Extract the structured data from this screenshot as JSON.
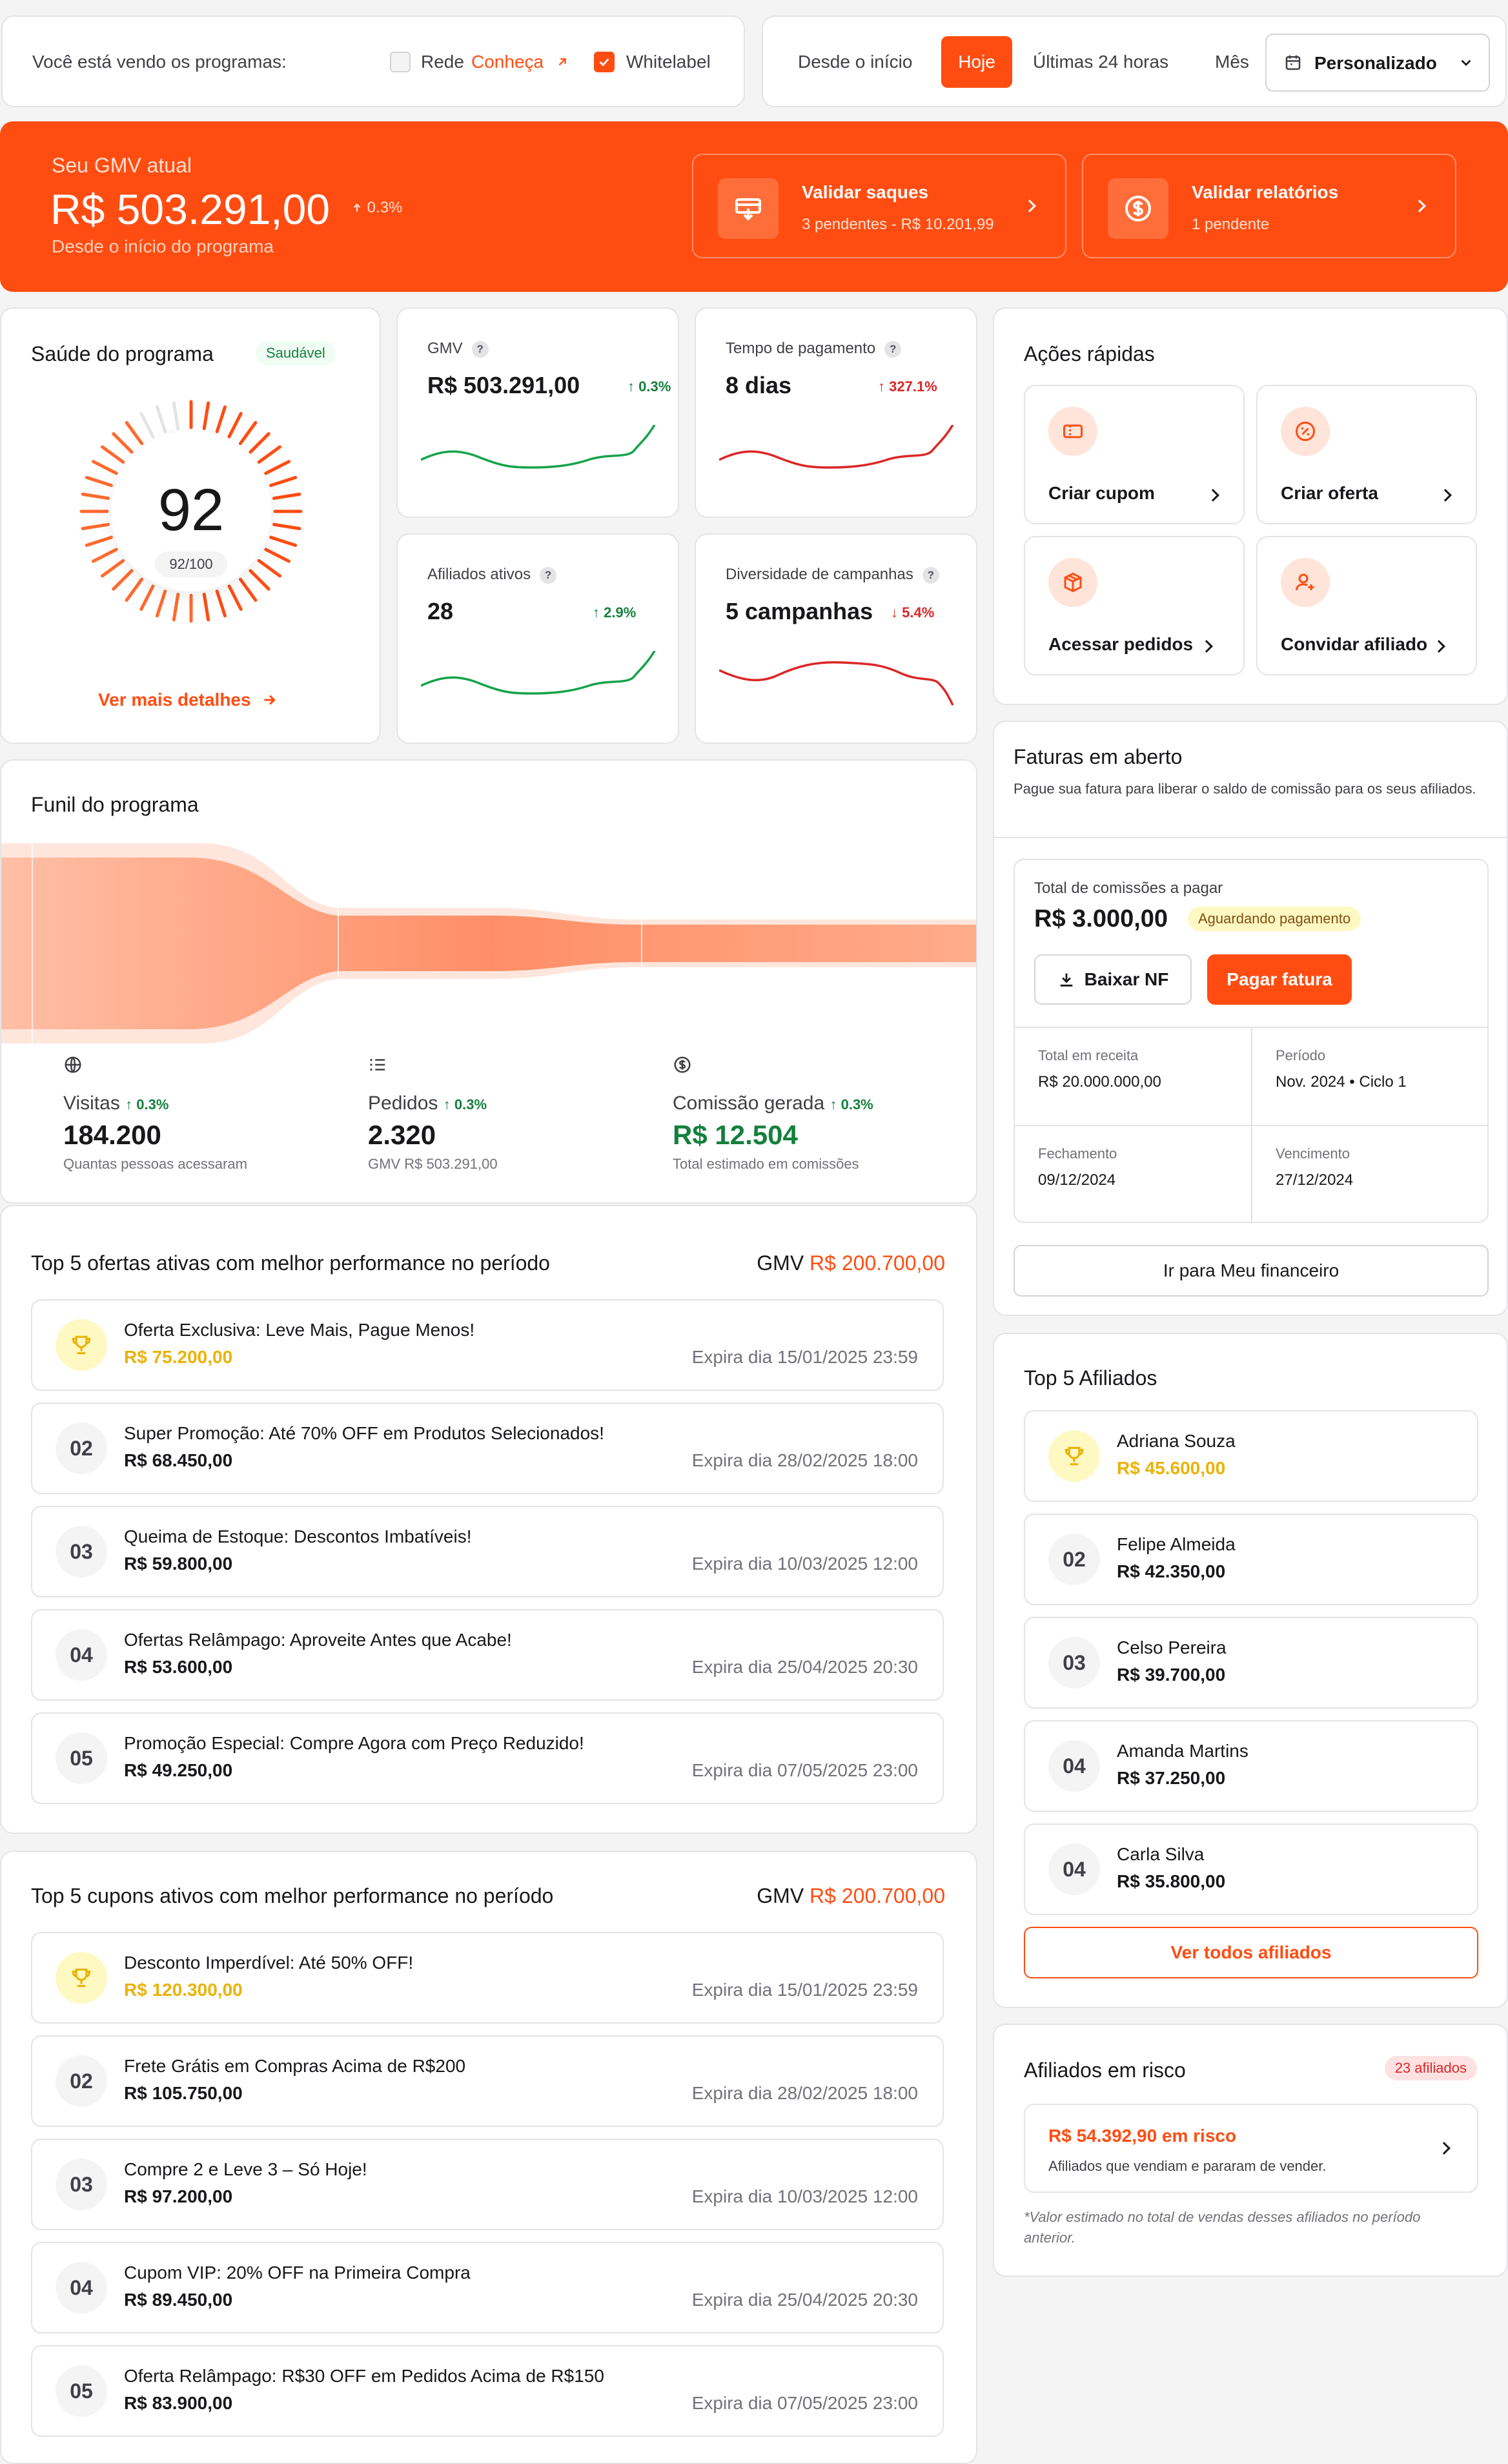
{
  "filter_bar": {
    "label": "Você está vendo os programas:",
    "rede_label": "Rede",
    "rede_link": "Conheça",
    "whitelabel_label": "Whitelabel"
  },
  "period_bar": {
    "options": [
      "Desde o início",
      "Hoje",
      "Últimas 24 horas",
      "Mês"
    ],
    "active": "Hoje",
    "custom_label": "Personalizado"
  },
  "hero": {
    "label": "Seu GMV atual",
    "value": "R$ 503.291,00",
    "change": "0.3%",
    "sub": "Desde o início do programa",
    "actions": [
      {
        "title": "Validar saques",
        "sub": "3 pendentes - R$ 10.201,99",
        "icon": "withdraw-icon"
      },
      {
        "title": "Validar relatórios",
        "sub": "1 pendente",
        "icon": "dollar-icon"
      }
    ]
  },
  "health": {
    "title": "Saúde do programa",
    "badge": "Saudável",
    "score": "92",
    "score_sub": "92/100",
    "score_value": 92,
    "link": "Ver mais detalhes"
  },
  "metrics": [
    {
      "label": "GMV",
      "value": "R$ 503.291,00",
      "change": "0.3%",
      "trend": "up"
    },
    {
      "label": "Tempo de pagamento",
      "value": "8 dias",
      "change": "327.1%",
      "trend": "up-bad"
    },
    {
      "label": "Afiliados ativos",
      "value": "28",
      "change": "2.9%",
      "trend": "up"
    },
    {
      "label": "Diversidade de campanhas",
      "value": "5 campanhas",
      "change": "5.4%",
      "trend": "down"
    }
  ],
  "quick_actions": {
    "title": "Ações rápidas",
    "items": [
      {
        "label": "Criar cupom",
        "icon": "ticket-icon"
      },
      {
        "label": "Criar oferta",
        "icon": "percent-icon"
      },
      {
        "label": "Acessar pedidos",
        "icon": "box-icon"
      },
      {
        "label": "Convidar afiliado",
        "icon": "user-plus-icon"
      }
    ]
  },
  "funnel": {
    "title": "Funil do programa",
    "stages": [
      {
        "label": "Visitas",
        "change": "0.3%",
        "value": "184.200",
        "sub": "Quantas pessoas acessaram",
        "icon": "globe-icon"
      },
      {
        "label": "Pedidos",
        "change": "0.3%",
        "value": "2.320",
        "sub": "GMV R$ 503.291,00",
        "icon": "list-icon"
      },
      {
        "label": "Comissão gerada",
        "change": "0.3%",
        "value": "R$ 12.504",
        "sub": "Total estimado em comissões",
        "icon": "coin-icon"
      }
    ]
  },
  "invoices": {
    "title": "Faturas em aberto",
    "sub": "Pague sua fatura para liberar o saldo de comissão para os seus afiliados.",
    "total_label": "Total de comissões a pagar",
    "total_value": "R$ 3.000,00",
    "status": "Aguardando pagamento",
    "download_label": "Baixar NF",
    "pay_label": "Pagar fatura",
    "fields": [
      {
        "label": "Total em receita",
        "value": "R$ 20.000.000,00"
      },
      {
        "label": "Período",
        "value": "Nov. 2024 • Ciclo 1"
      },
      {
        "label": "Fechamento",
        "value": "09/12/2024"
      },
      {
        "label": "Vencimento",
        "value": "27/12/2024"
      }
    ],
    "link_label": "Ir para Meu financeiro"
  },
  "top_offers": {
    "title": "Top 5 ofertas ativas com melhor performance no período",
    "gmv_label": "GMV",
    "gmv_value": "R$ 200.700,00",
    "items": [
      {
        "rank": "",
        "title": "Oferta Exclusiva: Leve Mais, Pague Menos!",
        "value": "R$ 75.200,00",
        "expires": "Expira dia 15/01/2025 23:59"
      },
      {
        "rank": "02",
        "title": "Super Promoção: Até 70% OFF em Produtos Selecionados!",
        "value": "R$ 68.450,00",
        "expires": "Expira dia 28/02/2025 18:00"
      },
      {
        "rank": "03",
        "title": "Queima de Estoque: Descontos Imbatíveis!",
        "value": "R$ 59.800,00",
        "expires": "Expira dia 10/03/2025 12:00"
      },
      {
        "rank": "04",
        "title": "Ofertas Relâmpago: Aproveite Antes que Acabe!",
        "value": "R$ 53.600,00",
        "expires": "Expira dia 25/04/2025 20:30"
      },
      {
        "rank": "05",
        "title": "Promoção Especial: Compre Agora com Preço Reduzido!",
        "value": "R$ 49.250,00",
        "expires": "Expira dia 07/05/2025 23:00"
      }
    ]
  },
  "top_coupons": {
    "title": "Top 5 cupons ativos com melhor performance no período",
    "gmv_label": "GMV",
    "gmv_value": "R$ 200.700,00",
    "items": [
      {
        "rank": "",
        "title": "Desconto Imperdível: Até 50% OFF!",
        "value": "R$ 120.300,00",
        "expires": "Expira dia 15/01/2025 23:59"
      },
      {
        "rank": "02",
        "title": "Frete Grátis em Compras Acima de R$200",
        "value": "R$ 105.750,00",
        "expires": "Expira dia 28/02/2025 18:00"
      },
      {
        "rank": "03",
        "title": "Compre 2 e Leve 3 – Só Hoje!",
        "value": "R$ 97.200,00",
        "expires": "Expira dia 10/03/2025 12:00"
      },
      {
        "rank": "04",
        "title": "Cupom VIP: 20% OFF na Primeira Compra",
        "value": "R$ 89.450,00",
        "expires": "Expira dia 25/04/2025 20:30"
      },
      {
        "rank": "05",
        "title": "Oferta Relâmpago: R$30 OFF em Pedidos Acima de R$150",
        "value": "R$ 83.900,00",
        "expires": "Expira dia 07/05/2025 23:00"
      }
    ]
  },
  "top_affiliates": {
    "title": "Top 5 Afiliados",
    "items": [
      {
        "rank": "",
        "name": "Adriana Souza",
        "value": "R$ 45.600,00"
      },
      {
        "rank": "02",
        "name": "Felipe Almeida",
        "value": "R$ 42.350,00"
      },
      {
        "rank": "03",
        "name": "Celso Pereira",
        "value": "R$ 39.700,00"
      },
      {
        "rank": "04",
        "name": "Amanda Martins",
        "value": "R$ 37.250,00"
      },
      {
        "rank": "04",
        "name": "Carla Silva",
        "value": "R$ 35.800,00"
      }
    ],
    "link_label": "Ver todos afiliados"
  },
  "risk": {
    "title": "Afiliados em risco",
    "badge": "23 afiliados",
    "value": "R$ 54.392,90 em risco",
    "sub": "Afiliados que vendiam e pararam de vender.",
    "note": "*Valor estimado no total de vendas desses afiliados no período anterior."
  },
  "colors": {
    "accent": "#ff4d12",
    "green": "#15803d",
    "red": "#dc2626",
    "gold": "#eab308"
  }
}
